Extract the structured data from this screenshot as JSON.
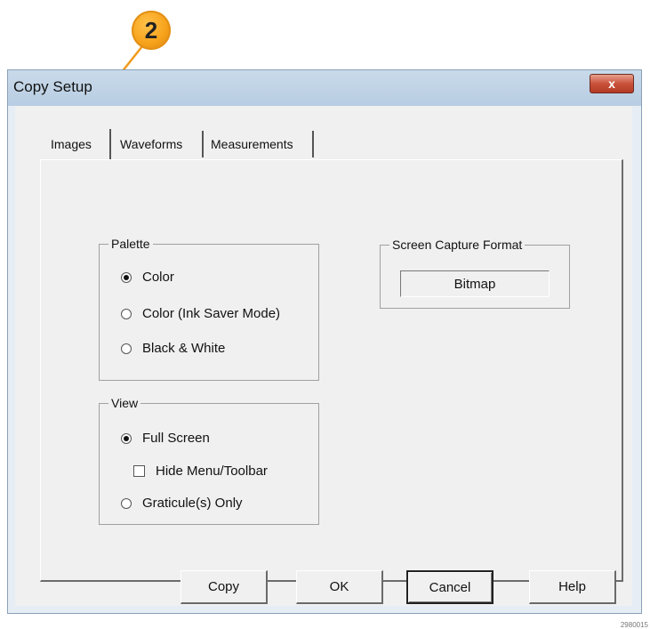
{
  "callout": {
    "number": "2"
  },
  "window": {
    "title": "Copy Setup",
    "close_label": "x"
  },
  "tabs": [
    {
      "label": "Images",
      "active": true
    },
    {
      "label": "Waveforms",
      "active": false
    },
    {
      "label": "Measurements",
      "active": false
    }
  ],
  "palette": {
    "label": "Palette",
    "options": [
      {
        "label": "Color",
        "selected": true
      },
      {
        "label": "Color (Ink Saver Mode)",
        "selected": false
      },
      {
        "label": "Black & White",
        "selected": false
      }
    ]
  },
  "view": {
    "label": "View",
    "full_screen": {
      "label": "Full Screen",
      "selected": true
    },
    "hide_menu": {
      "label": "Hide Menu/Toolbar",
      "checked": false
    },
    "graticule": {
      "label": "Graticule(s) Only",
      "selected": false
    }
  },
  "screen_capture": {
    "label": "Screen Capture Format",
    "value": "Bitmap"
  },
  "buttons": {
    "copy": "Copy",
    "ok": "OK",
    "cancel": "Cancel",
    "help": "Help"
  },
  "figure_code": "2980015"
}
